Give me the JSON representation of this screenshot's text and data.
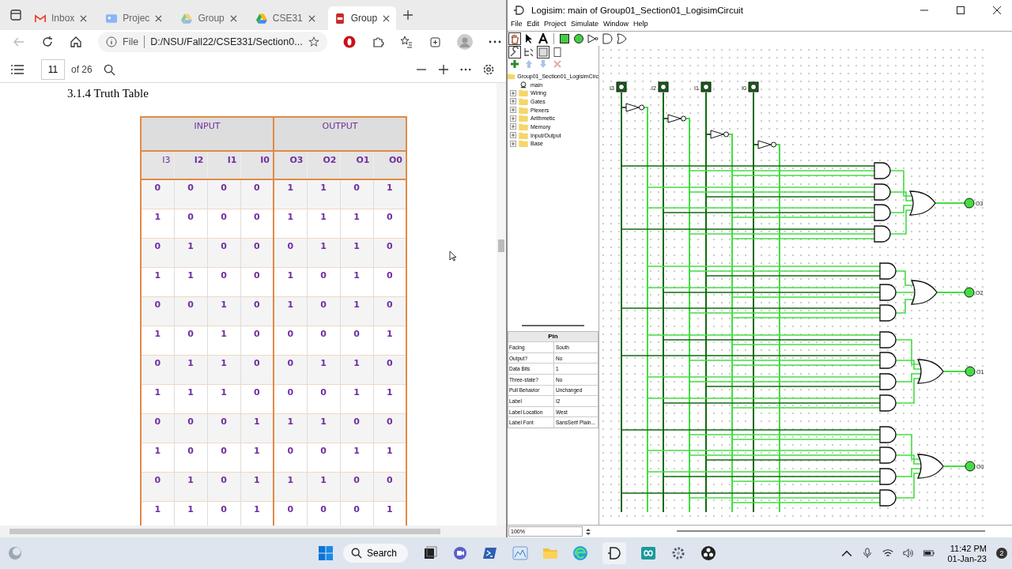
{
  "browser": {
    "tabs": [
      {
        "label": "Inbox",
        "kind": "mail",
        "selected": false
      },
      {
        "label": "Projec",
        "kind": "contacts",
        "selected": false
      },
      {
        "label": "Group",
        "kind": "drive-grey",
        "selected": false
      },
      {
        "label": "CSE31",
        "kind": "drive",
        "selected": false
      },
      {
        "label": "Group",
        "kind": "pdf",
        "selected": true
      }
    ],
    "address": {
      "scheme": "File",
      "url": "D:/NSU/Fall22/CSE331/Section0..."
    },
    "pdf_toolbar": {
      "page": "11",
      "page_count": "of 26"
    },
    "document": {
      "heading": "3.1.4 Truth Table",
      "table": {
        "groups": [
          "INPUT",
          "OUTPUT"
        ],
        "columns": [
          "I3",
          "I2",
          "I1",
          "I0",
          "O3",
          "O2",
          "O1",
          "O0"
        ],
        "rows": [
          [
            "0",
            "0",
            "0",
            "0",
            "1",
            "1",
            "0",
            "1"
          ],
          [
            "1",
            "0",
            "0",
            "0",
            "1",
            "1",
            "1",
            "0"
          ],
          [
            "0",
            "1",
            "0",
            "0",
            "0",
            "1",
            "1",
            "0"
          ],
          [
            "1",
            "1",
            "0",
            "0",
            "1",
            "0",
            "1",
            "0"
          ],
          [
            "0",
            "0",
            "1",
            "0",
            "1",
            "0",
            "1",
            "0"
          ],
          [
            "1",
            "0",
            "1",
            "0",
            "0",
            "0",
            "0",
            "1"
          ],
          [
            "0",
            "1",
            "1",
            "0",
            "0",
            "1",
            "1",
            "0"
          ],
          [
            "1",
            "1",
            "1",
            "0",
            "0",
            "0",
            "1",
            "1"
          ],
          [
            "0",
            "0",
            "0",
            "1",
            "1",
            "1",
            "0",
            "0"
          ],
          [
            "1",
            "0",
            "0",
            "1",
            "0",
            "0",
            "1",
            "1"
          ],
          [
            "0",
            "1",
            "0",
            "1",
            "1",
            "1",
            "0",
            "0"
          ],
          [
            "1",
            "1",
            "0",
            "1",
            "0",
            "0",
            "0",
            "1"
          ]
        ]
      }
    }
  },
  "logisim": {
    "title": "Logisim: main of Group01_Section01_LogisimCircuit",
    "menu": [
      "File",
      "Edit",
      "Project",
      "Simulate",
      "Window",
      "Help"
    ],
    "tree": {
      "label": "Group01_Section01_LogisimCirc",
      "children": [
        {
          "label": "main",
          "kind": "circuit"
        },
        {
          "label": "Wiring",
          "kind": "folder",
          "expanded": false
        },
        {
          "label": "Gates",
          "kind": "folder",
          "expanded": false
        },
        {
          "label": "Plexers",
          "kind": "folder",
          "expanded": false
        },
        {
          "label": "Arithmetic",
          "kind": "folder",
          "expanded": false
        },
        {
          "label": "Memory",
          "kind": "folder",
          "expanded": false
        },
        {
          "label": "Input/Output",
          "kind": "folder",
          "expanded": false
        },
        {
          "label": "Base",
          "kind": "folder",
          "expanded": false
        }
      ]
    },
    "attributes": {
      "title": "Pin",
      "rows": [
        {
          "name": "Facing",
          "value": "South"
        },
        {
          "name": "Output?",
          "value": "No"
        },
        {
          "name": "Data Bits",
          "value": "1"
        },
        {
          "name": "Three-state?",
          "value": "No"
        },
        {
          "name": "Pull Behavior",
          "value": "Unchanged"
        },
        {
          "name": "Label",
          "value": "I2"
        },
        {
          "name": "Label Location",
          "value": "West"
        },
        {
          "name": "Label Font",
          "value": "SansSerif Plain..."
        }
      ]
    },
    "zoom": "100%",
    "circuit": {
      "inputs": [
        {
          "label": "I3",
          "on": false
        },
        {
          "label": "I2",
          "on": false
        },
        {
          "label": "I1",
          "on": false
        },
        {
          "label": "I0",
          "on": false
        }
      ],
      "outputs": [
        {
          "label": "O3",
          "on": true
        },
        {
          "label": "O2",
          "on": true
        },
        {
          "label": "O1",
          "on": true
        },
        {
          "label": "O0",
          "on": true
        }
      ]
    }
  },
  "taskbar": {
    "search": "Search",
    "time": "11:42 PM",
    "date": "01-Jan-23",
    "notifications": "2"
  }
}
